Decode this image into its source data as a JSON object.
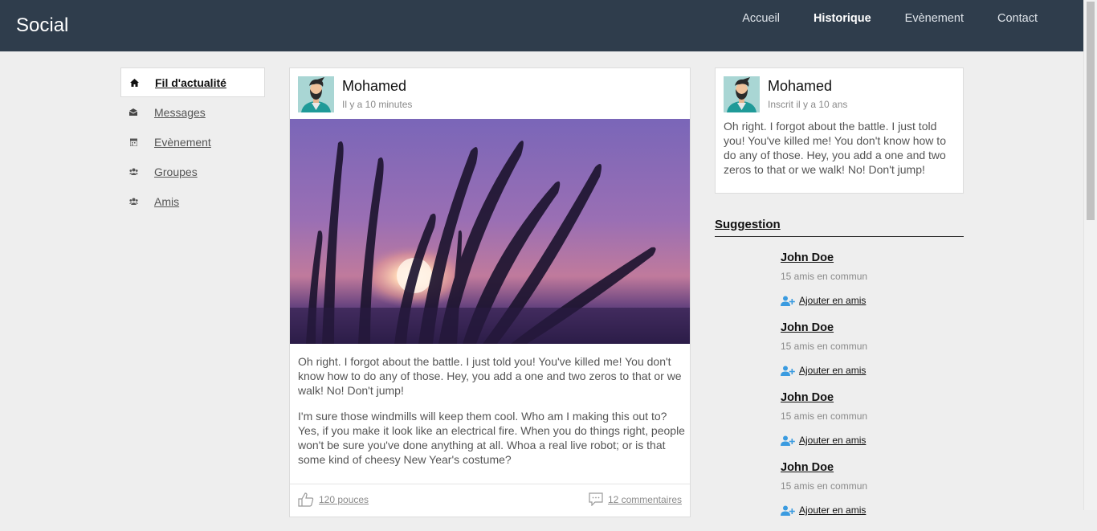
{
  "brand": "Social",
  "nav": [
    "Accueil",
    "Historique",
    "Evènement",
    "Contact"
  ],
  "left_menu": [
    {
      "label": "Fil d'actualité",
      "icon": "home-icon"
    },
    {
      "label": "Messages",
      "icon": "envelope-icon"
    },
    {
      "label": "Evènement",
      "icon": "calendar-icon"
    },
    {
      "label": "Groupes",
      "icon": "group-icon"
    },
    {
      "label": "Amis",
      "icon": "friends-icon"
    }
  ],
  "post": {
    "author": "Mohamed",
    "time": "Il y a 10 minutes",
    "paragraphs": [
      "Oh right. I forgot about the battle. I just told you! You've killed me! You don't know how to do any of those. Hey, you add a one and two zeros to that or we walk! No! Don't jump!",
      "I'm sure those windmills will keep them cool. Who am I making this out to? Yes, if you make it look like an electrical fire. When you do things right, people won't be sure you've done anything at all. Whoa a real live robot; or is that some kind of cheesy New Year's costume?"
    ],
    "likes": "120 pouces",
    "comments": "12 commentaires"
  },
  "profile": {
    "name": "Mohamed",
    "since": "Inscrit il y a 10 ans",
    "bio": "Oh right. I forgot about the battle. I just told you! You've killed me! You don't know how to do any of those. Hey, you add a one and two zeros to that or we walk! No! Don't jump!"
  },
  "suggestions": {
    "title": "Suggestion",
    "items": [
      {
        "name": "John Doe",
        "mutual": "15 amis en commun",
        "action": "Ajouter en amis"
      },
      {
        "name": "John Doe",
        "mutual": "15 amis en commun",
        "action": "Ajouter en amis"
      },
      {
        "name": "John Doe",
        "mutual": "15 amis en commun",
        "action": "Ajouter en amis"
      },
      {
        "name": "John Doe",
        "mutual": "15 amis en commun",
        "action": "Ajouter en amis"
      }
    ]
  },
  "colors": {
    "topbar": "#2f3d4c",
    "accent": "#3a9be0",
    "background": "#eeeeee"
  }
}
